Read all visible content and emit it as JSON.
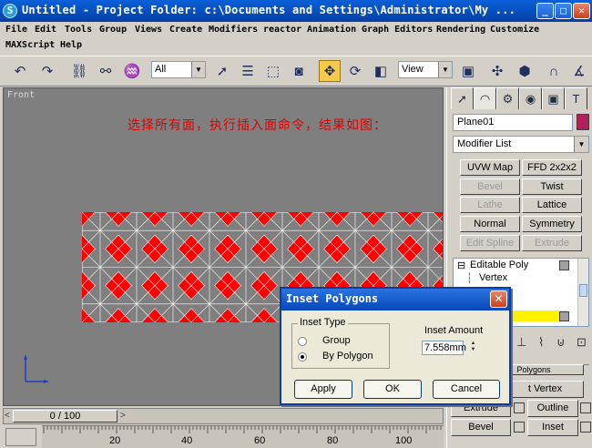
{
  "window": {
    "title": "Untitled    - Project Folder: c:\\Documents and Settings\\Administrator\\My ...",
    "app_icon_label": "S",
    "minimize_label": "_",
    "maximize_label": "□",
    "close_label": "✕"
  },
  "menu": {
    "row1": [
      "File",
      "Edit",
      "Tools",
      "Group",
      "Views",
      "Create",
      "Modifiers",
      "reactor",
      "Animation",
      "Graph Editors",
      "Rendering",
      "Customize"
    ],
    "row2": [
      "MAXScript",
      "Help"
    ]
  },
  "toolbar": {
    "selection_filter": "All",
    "coordinate_system": "View",
    "active_tool": "select-and-move"
  },
  "viewport": {
    "label": "Front",
    "annotation": "选择所有面，执行插入面命令，结果如图：",
    "background_color": "#7f7f7f",
    "polygon_fill_color": "#ff0000",
    "wire_color": "#ffffff"
  },
  "timeline": {
    "slider_text": "0 / 100",
    "prev_arrow": "<",
    "next_arrow": ">",
    "ticks": [
      "20",
      "40",
      "60",
      "80",
      "100"
    ]
  },
  "command_panel": {
    "object_name": "Plane01",
    "object_color": "#b0205a",
    "modifier_list_label": "Modifier List",
    "modifier_buttons": [
      {
        "label": "UVW Map",
        "enabled": true
      },
      {
        "label": "FFD 2x2x2",
        "enabled": true
      },
      {
        "label": "Bevel",
        "enabled": false
      },
      {
        "label": "Twist",
        "enabled": true
      },
      {
        "label": "Lathe",
        "enabled": false
      },
      {
        "label": "Lattice",
        "enabled": true
      },
      {
        "label": "Normal",
        "enabled": true
      },
      {
        "label": "Symmetry",
        "enabled": true
      },
      {
        "label": "Edit Spline",
        "enabled": false
      },
      {
        "label": "Extrude",
        "enabled": false
      }
    ],
    "stack": {
      "expand_marker": "⊟",
      "root_item": "Editable Poly",
      "sub_item": "Vertex"
    },
    "edit_buttons": {
      "partial_top": "Polygons",
      "insert_vertex": "t Vertex",
      "extrude": "Extrude",
      "outline": "Outline",
      "bevel": "Bevel",
      "inset": "Inset"
    }
  },
  "dialog": {
    "title": "Inset Polygons",
    "close_label": "✕",
    "inset_type_label": "Inset Type",
    "options": [
      {
        "label": "Group",
        "selected": false
      },
      {
        "label": "By Polygon",
        "selected": true
      }
    ],
    "inset_amount_label": "Inset Amount",
    "inset_amount_value": "7.558mm",
    "apply_label": "Apply",
    "ok_label": "OK",
    "cancel_label": "Cancel"
  }
}
